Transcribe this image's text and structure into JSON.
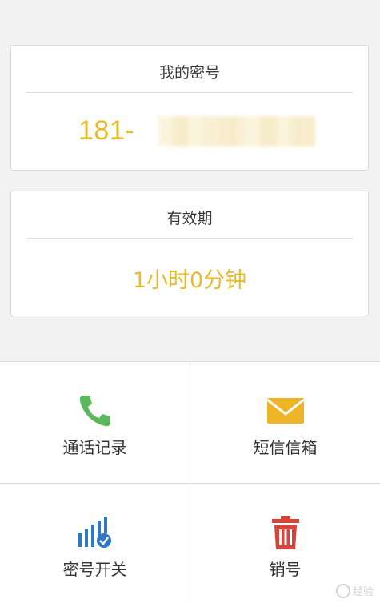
{
  "my_number": {
    "title": "我的密号",
    "value": "181-"
  },
  "expiry": {
    "title": "有效期",
    "value": "1小时0分钟"
  },
  "actions": [
    {
      "label": "通话记录",
      "icon": "phone-icon",
      "color": "#5cb85c"
    },
    {
      "label": "短信信箱",
      "icon": "envelope-icon",
      "color": "#f0b429"
    },
    {
      "label": "密号开关",
      "icon": "signal-toggle-icon",
      "color": "#2f78c4"
    },
    {
      "label": "销号",
      "icon": "trash-icon",
      "color": "#d9443a"
    }
  ],
  "watermark": {
    "text": "经验"
  },
  "colors": {
    "accent": "#e9bb2c",
    "background": "#f2f2f2",
    "card": "#ffffff"
  }
}
